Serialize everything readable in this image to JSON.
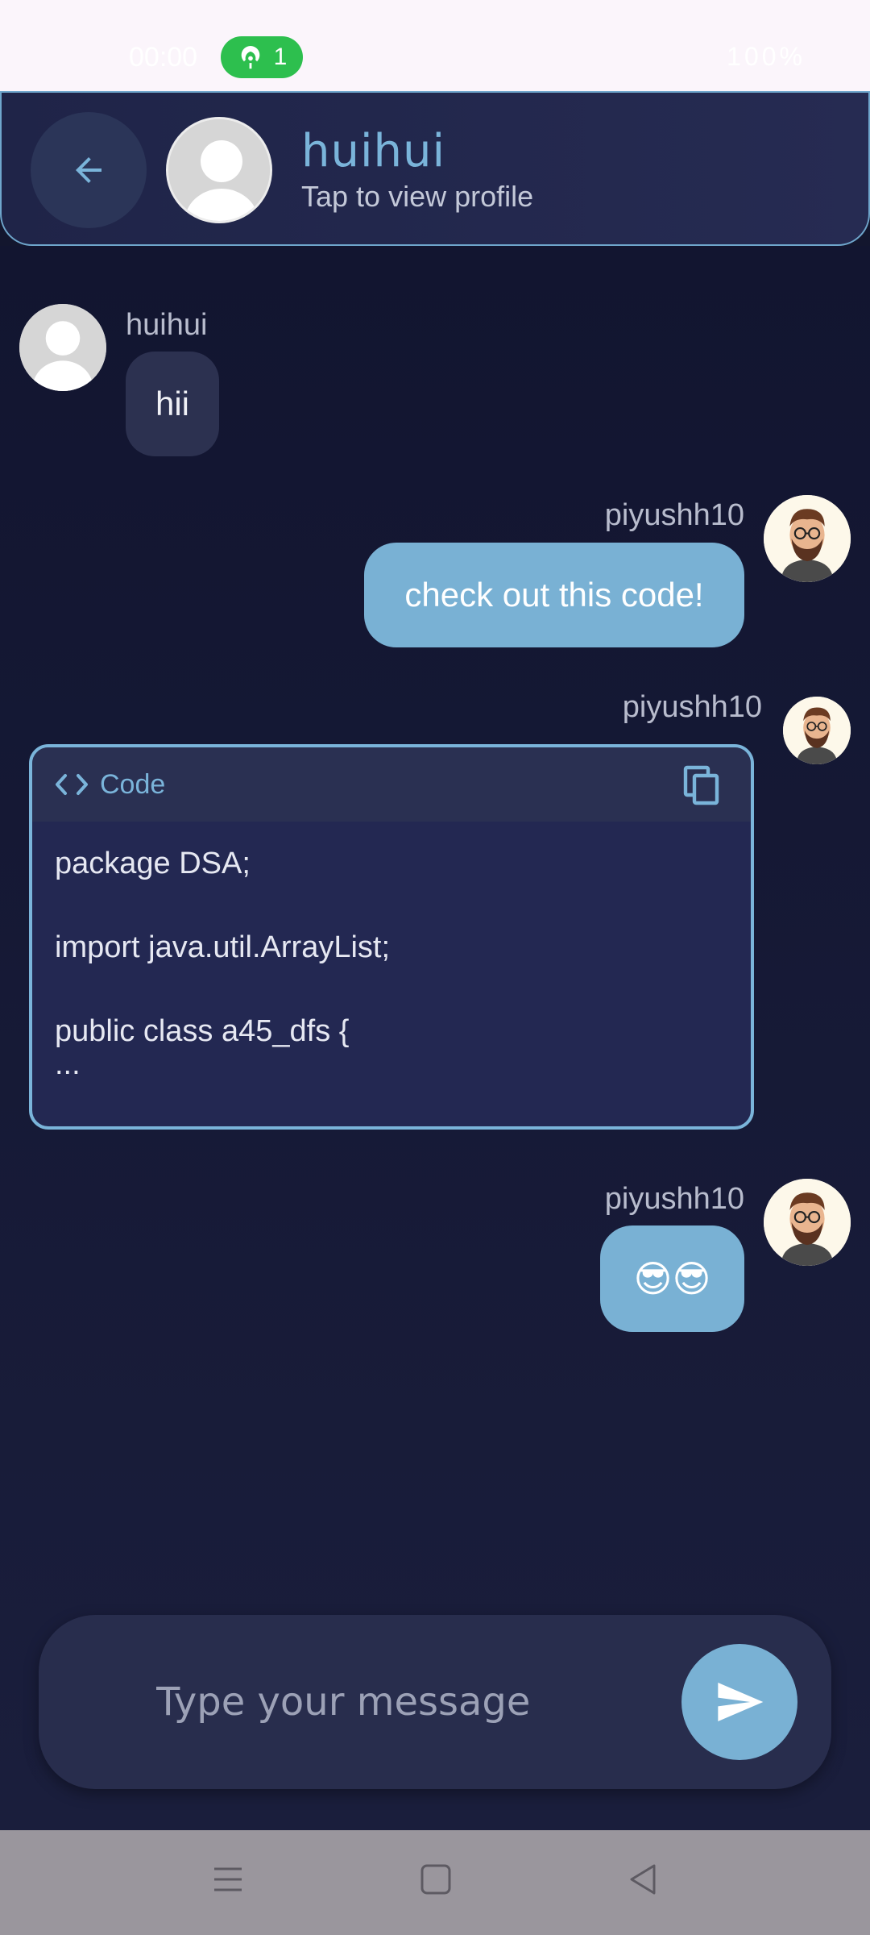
{
  "status_bar": {
    "time": "00:00",
    "hotspot_count": "1",
    "battery": "100%"
  },
  "header": {
    "title": "huihui",
    "subtitle": "Tap to view profile"
  },
  "messages": [
    {
      "sender": "huihui",
      "text": "hii",
      "direction": "incoming"
    },
    {
      "sender": "piyushh10",
      "text": "check out this code!",
      "direction": "outgoing"
    },
    {
      "sender": "piyushh10",
      "type": "code",
      "direction": "outgoing"
    },
    {
      "sender": "piyushh10",
      "text": "😎😎",
      "direction": "outgoing"
    }
  ],
  "code_block": {
    "label": "Code",
    "lines": [
      "package DSA;",
      "",
      "import java.util.ArrayList;",
      "",
      "public class a45_dfs {",
      "..."
    ]
  },
  "composer": {
    "placeholder": "Type your message"
  },
  "colors": {
    "accent": "#79b1d4",
    "background": "#13162e",
    "header_border": "#6fa6cc"
  }
}
